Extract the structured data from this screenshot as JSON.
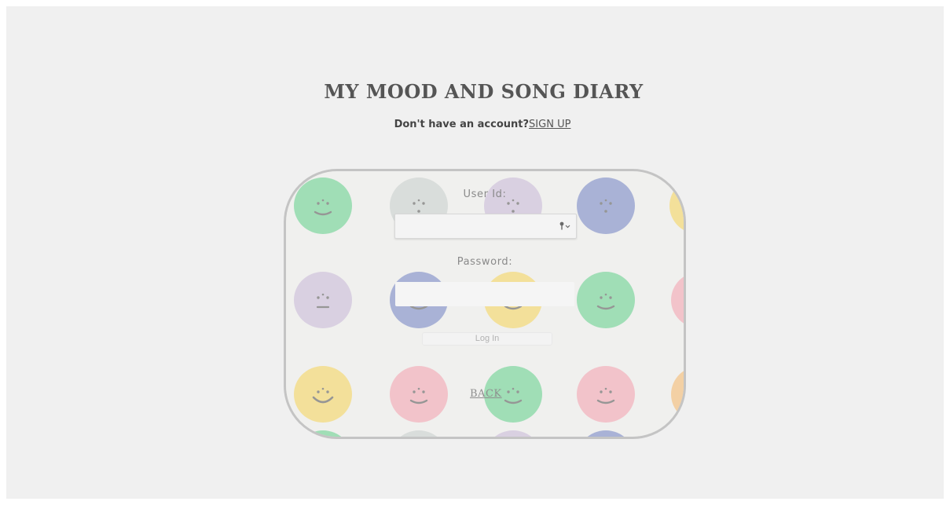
{
  "header": {
    "title": "MY MOOD AND SONG DIARY",
    "signup_prompt": "Don't have an account?",
    "signup_link": "SIGN UP"
  },
  "login_form": {
    "userid_label": "User Id:",
    "userid_value": "",
    "password_label": "Password:",
    "password_value": "",
    "login_button": "Log In",
    "back_link": "BACK"
  },
  "colors": {
    "page_background": "#f0f0f0",
    "card_border": "#c4c4c4",
    "face_green": "#66d08e",
    "face_gray": "#c9cfcd",
    "face_lavender": "#c9b9d8",
    "face_blue": "#7586c4",
    "face_yellow": "#f5d45e",
    "face_pink": "#f3a3b0",
    "face_orange": "#f5b86e"
  }
}
